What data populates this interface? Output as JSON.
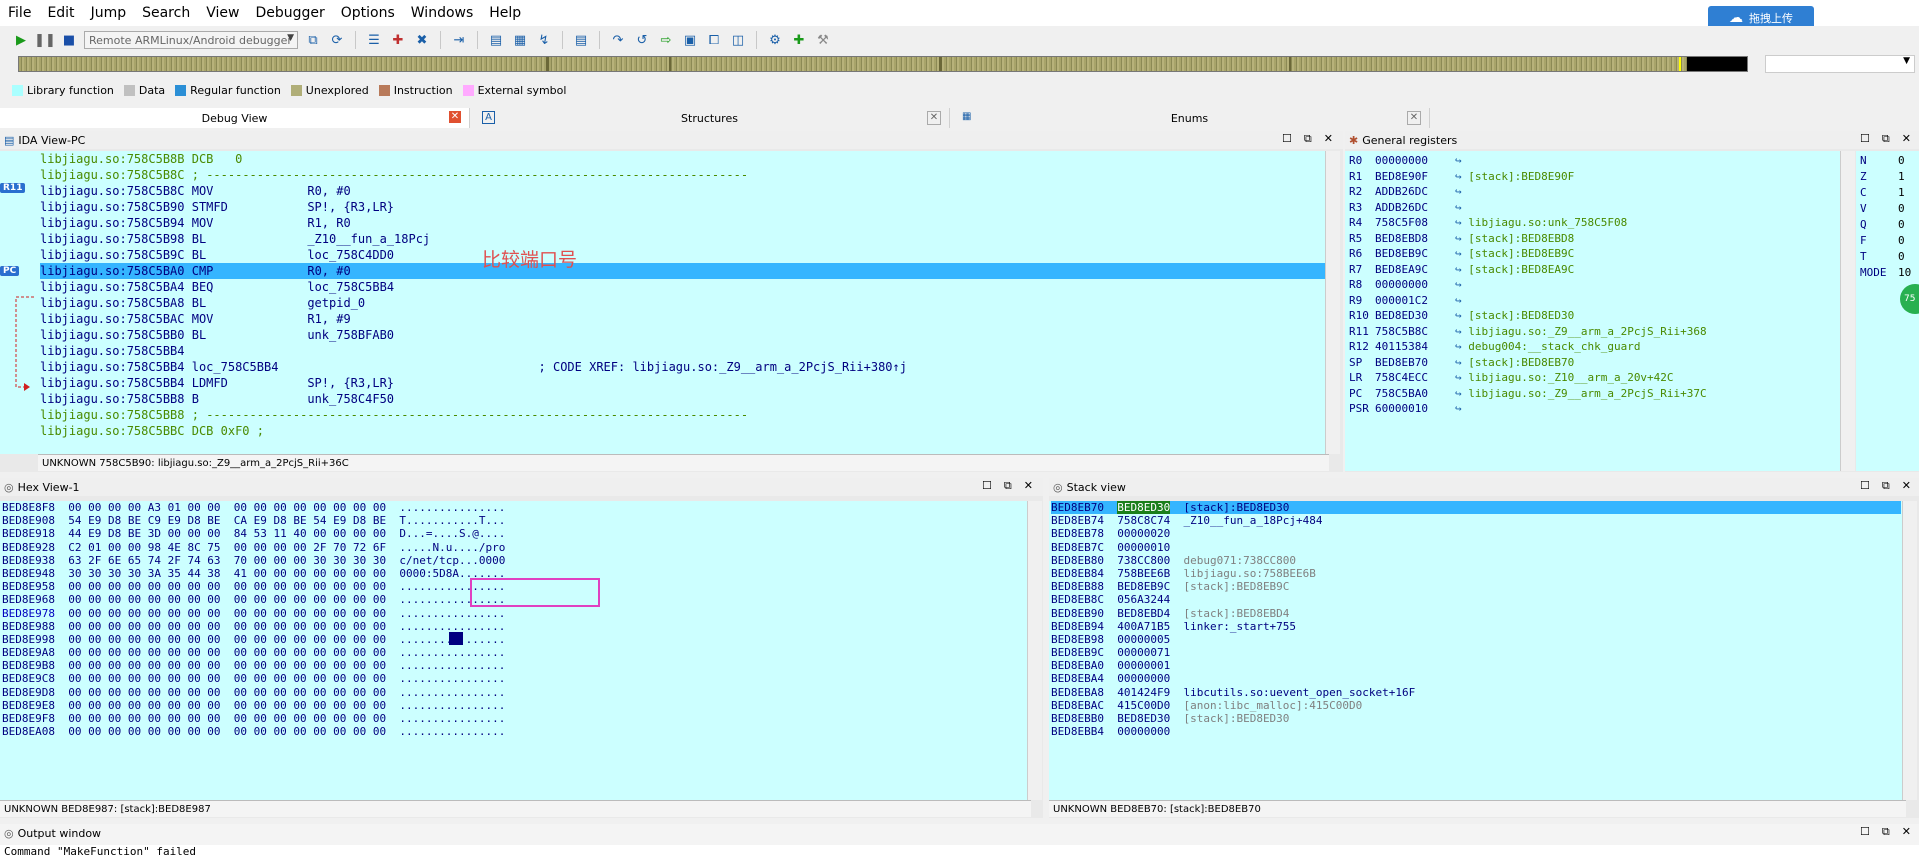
{
  "menu": [
    "File",
    "Edit",
    "Jump",
    "Search",
    "View",
    "Debugger",
    "Options",
    "Windows",
    "Help"
  ],
  "cloud_button": "拖拽上传",
  "debugger_select": "Remote ARMLinux/Android debugger",
  "legend": [
    {
      "label": "Library function",
      "color": "#aaffff"
    },
    {
      "label": "Data",
      "color": "#c0c0c0"
    },
    {
      "label": "Regular function",
      "color": "#2b8fd6"
    },
    {
      "label": "Unexplored",
      "color": "#b0ae78"
    },
    {
      "label": "Instruction",
      "color": "#b87a5a"
    },
    {
      "label": "External symbol",
      "color": "#ffaaff"
    }
  ],
  "tabs": [
    {
      "label": "Debug View"
    },
    {
      "label": "Structures"
    },
    {
      "label": "Enums"
    }
  ],
  "ida": {
    "title": "IDA View-PC",
    "annotation": "比较端口号",
    "status": "UNKNOWN 758C5B90: libjiagu.so:_Z9__arm_a_2PcjS_Rii+36C",
    "lines": [
      {
        "addr": "libjiagu.so:758C5B8B",
        "op": "DCB",
        "args": "   0",
        "style": "green"
      },
      {
        "addr": "libjiagu.so:758C5B8C",
        "op": ";",
        "args": " ---------------------------------------------------------------------------",
        "style": "green"
      },
      {
        "addr": "libjiagu.so:758C5B8C",
        "op": "MOV",
        "args": "             R0, #0",
        "style": "blue"
      },
      {
        "addr": "libjiagu.so:758C5B90",
        "op": "STMFD",
        "args": "           SP!, {R3,LR}",
        "style": "blue"
      },
      {
        "addr": "libjiagu.so:758C5B94",
        "op": "MOV",
        "args": "             R1, R0",
        "style": "blue"
      },
      {
        "addr": "libjiagu.so:758C5B98",
        "op": "BL",
        "args": "              _Z10__fun_a_18Pcj",
        "style": "blue"
      },
      {
        "addr": "libjiagu.so:758C5B9C",
        "op": "BL",
        "args": "              loc_758C4DD0",
        "style": "blue"
      },
      {
        "addr": "libjiagu.so:758C5BA0",
        "op": "CMP",
        "args": "             R0, #0",
        "style": "blue"
      },
      {
        "addr": "libjiagu.so:758C5BA4",
        "op": "BEQ",
        "args": "             loc_758C5BB4",
        "style": "blue"
      },
      {
        "addr": "libjiagu.so:758C5BA8",
        "op": "BL",
        "args": "              getpid_0",
        "style": "blue"
      },
      {
        "addr": "libjiagu.so:758C5BAC",
        "op": "MOV",
        "args": "             R1, #9",
        "style": "blue"
      },
      {
        "addr": "libjiagu.so:758C5BB0",
        "op": "BL",
        "args": "              unk_758BFAB0",
        "style": "blue"
      },
      {
        "addr": "libjiagu.so:758C5BB4",
        "op": "",
        "args": "",
        "style": "blue"
      },
      {
        "addr": "libjiagu.so:758C5BB4",
        "op": "loc_758C5BB4",
        "args": "                                    ; CODE XREF: libjiagu.so:_Z9__arm_a_2PcjS_Rii+380↑j",
        "style": "blue"
      },
      {
        "addr": "libjiagu.so:758C5BB4",
        "op": "LDMFD",
        "args": "           SP!, {R3,LR}",
        "style": "blue"
      },
      {
        "addr": "libjiagu.so:758C5BB8",
        "op": "B",
        "args": "               unk_758C4F50",
        "style": "blue"
      },
      {
        "addr": "libjiagu.so:758C5BB8",
        "op": ";",
        "args": " ---------------------------------------------------------------------------",
        "style": "green"
      },
      {
        "addr": "libjiagu.so:758C5BBC",
        "op": "DCB 0xF0 ;",
        "args": "",
        "style": "green"
      }
    ]
  },
  "registers": {
    "title": "General registers",
    "items": [
      {
        "name": "R0",
        "value": "00000000",
        "desc": ""
      },
      {
        "name": "R1",
        "value": "BED8E90F",
        "desc": "[stack]:BED8E90F"
      },
      {
        "name": "R2",
        "value": "ADDB26DC",
        "desc": ""
      },
      {
        "name": "R3",
        "value": "ADDB26DC",
        "desc": ""
      },
      {
        "name": "R4",
        "value": "758C5F08",
        "desc": "libjiagu.so:unk_758C5F08"
      },
      {
        "name": "R5",
        "value": "BED8EBD8",
        "desc": "[stack]:BED8EBD8"
      },
      {
        "name": "R6",
        "value": "BED8EB9C",
        "desc": "[stack]:BED8EB9C"
      },
      {
        "name": "R7",
        "value": "BED8EA9C",
        "desc": "[stack]:BED8EA9C"
      },
      {
        "name": "R8",
        "value": "00000000",
        "desc": ""
      },
      {
        "name": "R9",
        "value": "000001C2",
        "desc": ""
      },
      {
        "name": "R10",
        "value": "BED8ED30",
        "desc": "[stack]:BED8ED30"
      },
      {
        "name": "R11",
        "value": "758C5B8C",
        "desc": "libjiagu.so:_Z9__arm_a_2PcjS_Rii+368"
      },
      {
        "name": "R12",
        "value": "40115384",
        "desc": "debug004:__stack_chk_guard"
      },
      {
        "name": "SP",
        "value": "BED8EB70",
        "desc": "[stack]:BED8EB70"
      },
      {
        "name": "LR",
        "value": "758C4ECC",
        "desc": "libjiagu.so:_Z10__arm_a_20v+42C"
      },
      {
        "name": "PC",
        "value": "758C5BA0",
        "desc": "libjiagu.so:_Z9__arm_a_2PcjS_Rii+37C"
      },
      {
        "name": "PSR",
        "value": "60000010",
        "desc": ""
      }
    ],
    "flags": [
      {
        "name": "N",
        "value": "0"
      },
      {
        "name": "Z",
        "value": "1"
      },
      {
        "name": "C",
        "value": "1"
      },
      {
        "name": "V",
        "value": "0"
      },
      {
        "name": "Q",
        "value": "0"
      },
      {
        "name": "F",
        "value": "0"
      },
      {
        "name": "T",
        "value": "0"
      },
      {
        "name": "MODE",
        "value": "10"
      }
    ]
  },
  "hex": {
    "title": "Hex View-1",
    "status": "UNKNOWN BED8E987: [stack]:BED8E987",
    "rows": [
      {
        "addr": "BED8E8F8",
        "bytes": "00 00 00 00 A3 01 00 00  00 00 00 00 00 00 00 00",
        "ascii": "................"
      },
      {
        "addr": "BED8E908",
        "bytes": "54 E9 D8 BE C9 E9 D8 BE  CA E9 D8 BE 54 E9 D8 BE",
        "ascii": "T...........T..."
      },
      {
        "addr": "BED8E918",
        "bytes": "44 E9 D8 BE 3D 00 00 00  84 53 11 40 00 00 00 00",
        "ascii": "D...=....S.@...."
      },
      {
        "addr": "BED8E928",
        "bytes": "C2 01 00 00 98 4E 8C 75  00 00 00 00 2F 70 72 6F",
        "ascii": ".....N.u..../pro"
      },
      {
        "addr": "BED8E938",
        "bytes": "63 2F 6E 65 74 2F 74 63  70 00 00 00 30 30 30 30",
        "ascii": "c/net/tcp...0000"
      },
      {
        "addr": "BED8E948",
        "bytes": "30 30 30 30 3A 35 44 38  41 00 00 00 00 00 00 00",
        "ascii": "0000:5D8A......."
      },
      {
        "addr": "BED8E958",
        "bytes": "00 00 00 00 00 00 00 00  00 00 00 00 00 00 00 00",
        "ascii": "................"
      },
      {
        "addr": "BED8E968",
        "bytes": "00 00 00 00 00 00 00 00  00 00 00 00 00 00 00 00",
        "ascii": "................"
      },
      {
        "addr": "BED8E978",
        "bytes": "00 00 00 00 00 00 00 00  00 00 00 00 00 00 00 00",
        "ascii": "................"
      },
      {
        "addr": "BED8E988",
        "bytes": "00 00 00 00 00 00 00 00  00 00 00 00 00 00 00 00",
        "ascii": "................"
      },
      {
        "addr": "BED8E998",
        "bytes": "00 00 00 00 00 00 00 00  00 00 00 00 00 00 00 00",
        "ascii": "................"
      },
      {
        "addr": "BED8E9A8",
        "bytes": "00 00 00 00 00 00 00 00  00 00 00 00 00 00 00 00",
        "ascii": "................"
      },
      {
        "addr": "BED8E9B8",
        "bytes": "00 00 00 00 00 00 00 00  00 00 00 00 00 00 00 00",
        "ascii": "................"
      },
      {
        "addr": "BED8E9C8",
        "bytes": "00 00 00 00 00 00 00 00  00 00 00 00 00 00 00 00",
        "ascii": "................"
      },
      {
        "addr": "BED8E9D8",
        "bytes": "00 00 00 00 00 00 00 00  00 00 00 00 00 00 00 00",
        "ascii": "................"
      },
      {
        "addr": "BED8E9E8",
        "bytes": "00 00 00 00 00 00 00 00  00 00 00 00 00 00 00 00",
        "ascii": "................"
      },
      {
        "addr": "BED8E9F8",
        "bytes": "00 00 00 00 00 00 00 00  00 00 00 00 00 00 00 00",
        "ascii": "................"
      },
      {
        "addr": "BED8EA08",
        "bytes": "00 00 00 00 00 00 00 00  00 00 00 00 00 00 00 00",
        "ascii": "................"
      }
    ]
  },
  "stack": {
    "title": "Stack view",
    "status": "UNKNOWN BED8EB70: [stack]:BED8EB70",
    "rows": [
      {
        "addr": "BED8EB70",
        "value": "BED8ED30",
        "desc": "[stack]:BED8ED30"
      },
      {
        "addr": "BED8EB74",
        "value": "758C8C74",
        "desc": "_Z10__fun_a_18Pcj+484"
      },
      {
        "addr": "BED8EB78",
        "value": "00000020",
        "desc": ""
      },
      {
        "addr": "BED8EB7C",
        "value": "00000010",
        "desc": ""
      },
      {
        "addr": "BED8EB80",
        "value": "738CC800",
        "desc": "debug071:738CC800"
      },
      {
        "addr": "BED8EB84",
        "value": "758BEE6B",
        "desc": "libjiagu.so:758BEE6B"
      },
      {
        "addr": "BED8EB88",
        "value": "BED8EB9C",
        "desc": "[stack]:BED8EB9C"
      },
      {
        "addr": "BED8EB8C",
        "value": "056A3244",
        "desc": ""
      },
      {
        "addr": "BED8EB90",
        "value": "BED8EBD4",
        "desc": "[stack]:BED8EBD4"
      },
      {
        "addr": "BED8EB94",
        "value": "400A71B5",
        "desc": "linker:_start+755"
      },
      {
        "addr": "BED8EB98",
        "value": "00000005",
        "desc": ""
      },
      {
        "addr": "BED8EB9C",
        "value": "00000071",
        "desc": ""
      },
      {
        "addr": "BED8EBA0",
        "value": "00000001",
        "desc": ""
      },
      {
        "addr": "BED8EBA4",
        "value": "00000000",
        "desc": ""
      },
      {
        "addr": "BED8EBA8",
        "value": "401424F9",
        "desc": "libcutils.so:uevent_open_socket+16F"
      },
      {
        "addr": "BED8EBAC",
        "value": "415C00D0",
        "desc": "[anon:libc_malloc]:415C00D0"
      },
      {
        "addr": "BED8EBB0",
        "value": "BED8ED30",
        "desc": "[stack]:BED8ED30"
      },
      {
        "addr": "BED8EBB4",
        "value": "00000000",
        "desc": ""
      }
    ]
  },
  "output": {
    "title": "Output window",
    "line": "Command \"MakeFunction\" failed"
  },
  "gutter": {
    "r11": "R11",
    "pc": "PC"
  },
  "badge": "75"
}
